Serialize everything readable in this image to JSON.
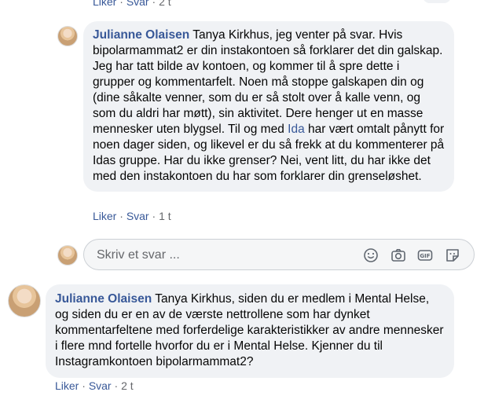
{
  "top_meta": {
    "like": "Liker",
    "sep1": " · ",
    "reply": "Svar",
    "sep2": " · ",
    "time": "2 t"
  },
  "comments": [
    {
      "author": "Julianne Olaisen",
      "text_before": " Tanya Kirkhus, jeg venter på svar. Hvis bipolarmammat2 er din instakontoen så forklarer det din galskap. Jeg har tatt bilde av kontoen, og kommer til å spre dette i grupper og kommentarfelt. Noen må stoppe galskapen din og (dine såkalte venner, som du er så stolt over å kalle venn, og som du aldri har møtt), sin aktivitet. Dere henger ut en masse mennesker uten blygsel. Til og med ",
      "mention": "Ida",
      "text_after": " har vært omtalt pånytt for noen dager siden, og likevel er du så frekk at du kommenterer på Idas gruppe. Har du ikke grenser? Nei, vent litt, du har ikke det med den instakontoen du har som forklarer din grenseløshet.",
      "like": "Liker",
      "reply": "Svar",
      "time": "1 t"
    },
    {
      "author": "Julianne Olaisen",
      "text_before": " Tanya Kirkhus, siden du er medlem i Mental Helse, og siden du er en av de værste nettrollene som har dynket kommentarfeltene med forferdelige karakteristikker av andre mennesker i flere mnd fortelle hvorfor du er i Mental Helse. Kjenner du til Instagramkontoen bipolarmammat2?",
      "mention": "",
      "text_after": "",
      "like": "Liker",
      "reply": "Svar",
      "time": "2 t"
    }
  ],
  "composer": {
    "placeholder": "Skriv et svar ...",
    "tools": [
      "emoji-icon",
      "camera-icon",
      "gif-icon",
      "sticker-icon"
    ]
  },
  "sep": " · "
}
